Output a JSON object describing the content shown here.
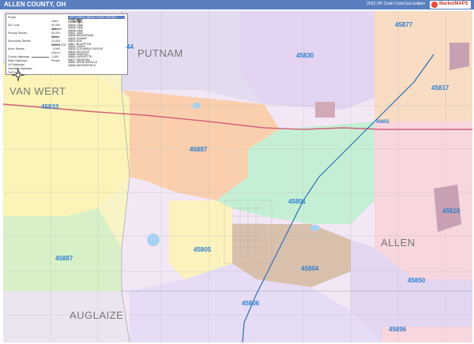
{
  "header": {
    "title": "ALLEN COUNTY, OH",
    "edition": "2022 ZIP Code ColorCast Edition",
    "brand": "MarketMAPS"
  },
  "legend": {
    "rows": [
      "Roads",
      "",
      "ZIP Code",
      "",
      "Primary Streets",
      "",
      "Secondary Streets",
      "",
      "Minor Streets",
      "",
      "County Highways",
      "State Highways",
      "US Highways",
      "Interstate Highways",
      "Toll Roads"
    ],
    "samples": [
      "Cities 99,999 - 499,999",
      "Cities 50,000 - 99,999",
      "Cities 10,000 - 49,999",
      "Cities 1,000 - 9,999",
      "Cities 1-1,000 People"
    ],
    "city_sample": "City",
    "table_header": "ZIP CODES / INDEX / POST OFFICE / TYPE",
    "table_rows": [
      "45801 LIMA",
      "45802 LIMA",
      "45804 LIMA",
      "45805 LIMA",
      "45806 LIMA",
      "45807 LIMA",
      "45808 BEAVERDAM",
      "45809 GOMER",
      "45810 ADA",
      "45817 BLUFFTON",
      "45820 CAIRO",
      "45830 COLUMBUS GROVE",
      "45833 DELPHOS",
      "45850 HARROD",
      "45854 LAFAYETTE",
      "45877 PANDORA",
      "45887 SPENCERVILLE",
      "45896 WAYNESFIELD"
    ]
  },
  "map": {
    "county_labels": [
      "PUTNAM",
      "VAN WERT",
      "ALLEN",
      "AUGLAIZE"
    ],
    "zip_labels": [
      "45877",
      "45830",
      "45817",
      "45833",
      "45855",
      "45887",
      "45801",
      "45810",
      "45805",
      "45804",
      "45887",
      "45850",
      "45806",
      "45896",
      "44"
    ]
  },
  "colors": {
    "header_bar": "#5a7fc0",
    "zip_label": "#2f7fd0",
    "county_label": "#777777",
    "interstate": "#2a6fb5",
    "us_highway": "#d2607a"
  }
}
